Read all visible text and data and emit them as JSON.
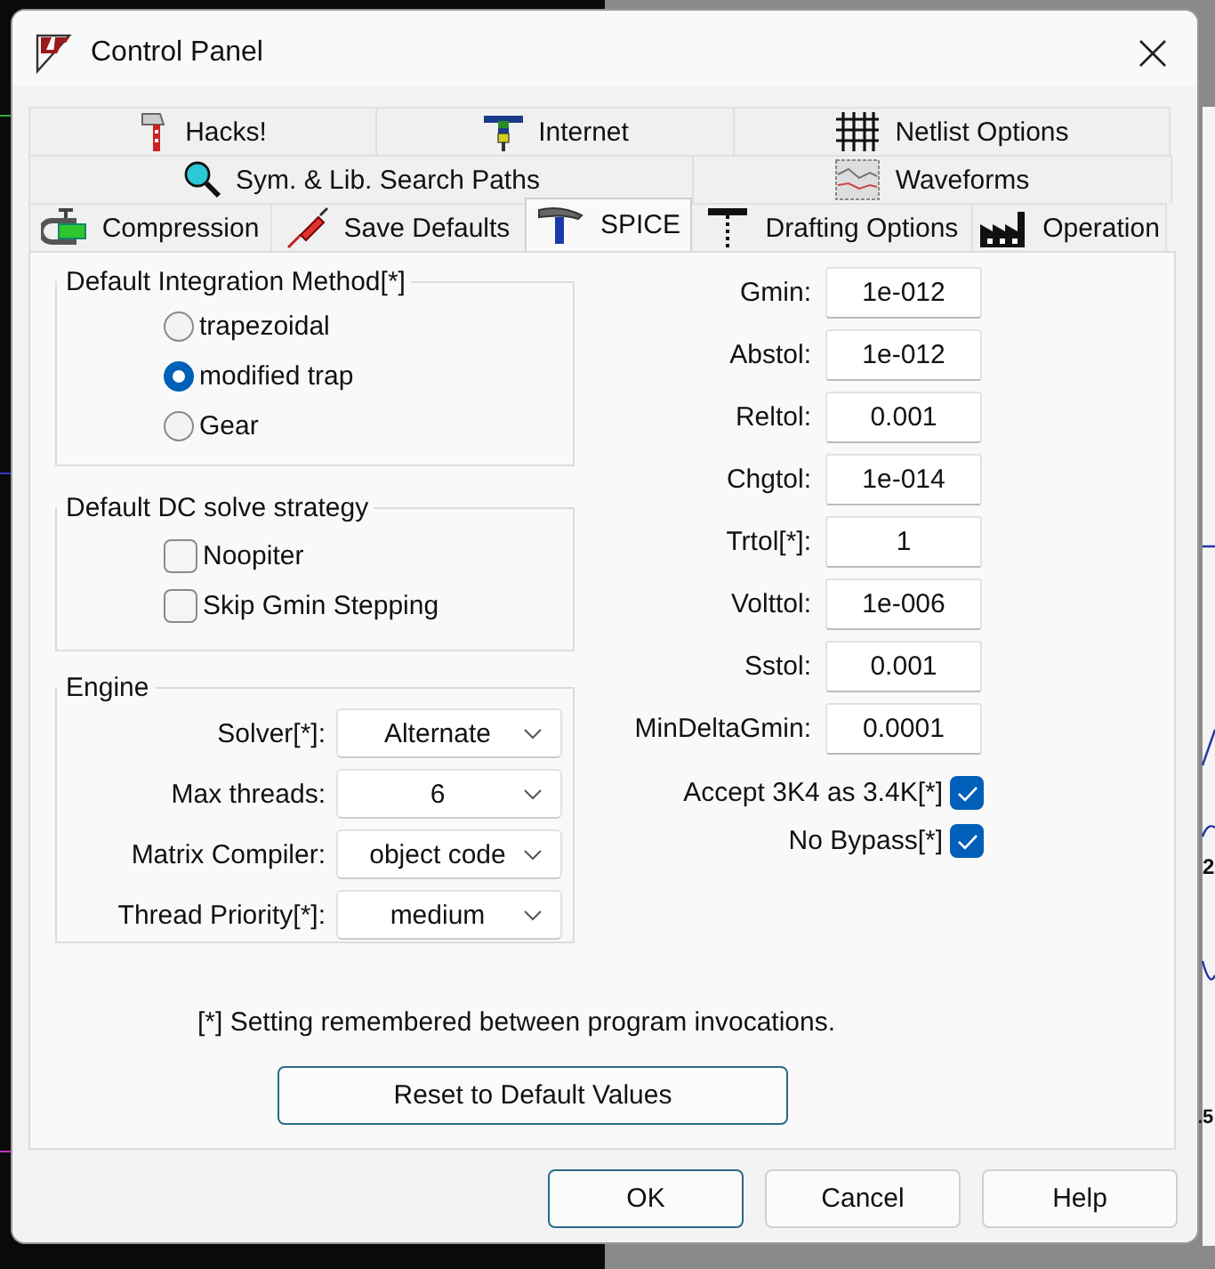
{
  "window": {
    "title": "Control Panel"
  },
  "tab_rows": [
    [
      {
        "label": "Hacks!",
        "selected": false
      },
      {
        "label": "Internet",
        "selected": false
      },
      {
        "label": "Netlist Options",
        "selected": false
      }
    ],
    [
      {
        "label": "Sym. & Lib. Search Paths",
        "selected": false
      },
      {
        "label": "Waveforms",
        "selected": false
      }
    ],
    [
      {
        "label": "Compression",
        "selected": false
      },
      {
        "label": "Save Defaults",
        "selected": false
      },
      {
        "label": "SPICE",
        "selected": true
      },
      {
        "label": "Drafting Options",
        "selected": false
      },
      {
        "label": "Operation",
        "selected": false
      }
    ]
  ],
  "integration": {
    "title": "Default Integration Method[*]",
    "options": [
      {
        "label": "trapezoidal",
        "selected": false
      },
      {
        "label": "modified trap",
        "selected": true
      },
      {
        "label": "Gear",
        "selected": false
      }
    ]
  },
  "dc_strategy": {
    "title": "Default DC solve strategy",
    "options": [
      {
        "label": "Noopiter",
        "checked": false
      },
      {
        "label": "Skip Gmin Stepping",
        "checked": false
      }
    ]
  },
  "engine": {
    "title": "Engine",
    "fields": [
      {
        "label": "Solver[*]:",
        "value": "Alternate"
      },
      {
        "label": "Max threads:",
        "value": "6"
      },
      {
        "label": "Matrix Compiler:",
        "value": "object code"
      },
      {
        "label": "Thread Priority[*]:",
        "value": "medium"
      }
    ]
  },
  "tolerances": [
    {
      "label": "Gmin:",
      "value": "1e-012"
    },
    {
      "label": "Abstol:",
      "value": "1e-012"
    },
    {
      "label": "Reltol:",
      "value": "0.001"
    },
    {
      "label": "Chgtol:",
      "value": "1e-014"
    },
    {
      "label": "Trtol[*]:",
      "value": "1"
    },
    {
      "label": "Volttol:",
      "value": "1e-006"
    },
    {
      "label": "Sstol:",
      "value": "0.001"
    },
    {
      "label": "MinDeltaGmin:",
      "value": "0.0001"
    }
  ],
  "options": [
    {
      "label": "Accept 3K4 as 3.4K[*]",
      "checked": true
    },
    {
      "label": "No Bypass[*]",
      "checked": true
    }
  ],
  "note": "[*] Setting remembered between program invocations.",
  "reset_button": "Reset to Default Values",
  "buttons": [
    "OK",
    "Cancel",
    "Help"
  ],
  "background": {
    "labels": [
      "2",
      ".5"
    ]
  }
}
